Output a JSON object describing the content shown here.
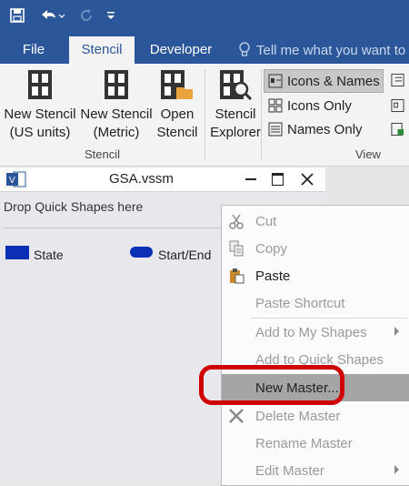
{
  "qat": {
    "save_icon": "save-icon",
    "undo_icon": "undo-icon",
    "redo_icon": "redo-icon",
    "customize_icon": "customize-qat-icon"
  },
  "tabs": [
    "File",
    "Stencil",
    "Developer"
  ],
  "tellme": "Tell me what you want to",
  "ribbon": {
    "btn_new_us": [
      "New Stencil",
      "(US units)"
    ],
    "btn_new_metric": [
      "New Stencil",
      "(Metric)"
    ],
    "btn_open": [
      "Open",
      "Stencil"
    ],
    "btn_explorer": [
      "Stencil",
      "Explorer"
    ],
    "group_stencil": "Stencil",
    "group_view": "View",
    "view_options": [
      "Icons & Names",
      "Icons Only",
      "Names Only"
    ]
  },
  "stencil": {
    "title": "GSA.vssm",
    "drop_text": "Drop Quick Shapes here",
    "shapes": [
      {
        "label": "State",
        "color": "#0a2fb4"
      },
      {
        "label": "Start/End",
        "color": "#0a2fb4"
      }
    ]
  },
  "context_menu": {
    "cut": "Cut",
    "copy": "Copy",
    "paste": "Paste",
    "paste_shortcut": "Paste Shortcut",
    "add_my_shapes": "Add to My Shapes",
    "add_quick_shapes": "Add to Quick Shapes",
    "new_master": "New Master...",
    "delete_master": "Delete Master",
    "rename_master": "Rename Master",
    "edit_master": "Edit Master"
  },
  "colors": {
    "accent": "#2b579a",
    "highlight_ring": "#d00000"
  }
}
